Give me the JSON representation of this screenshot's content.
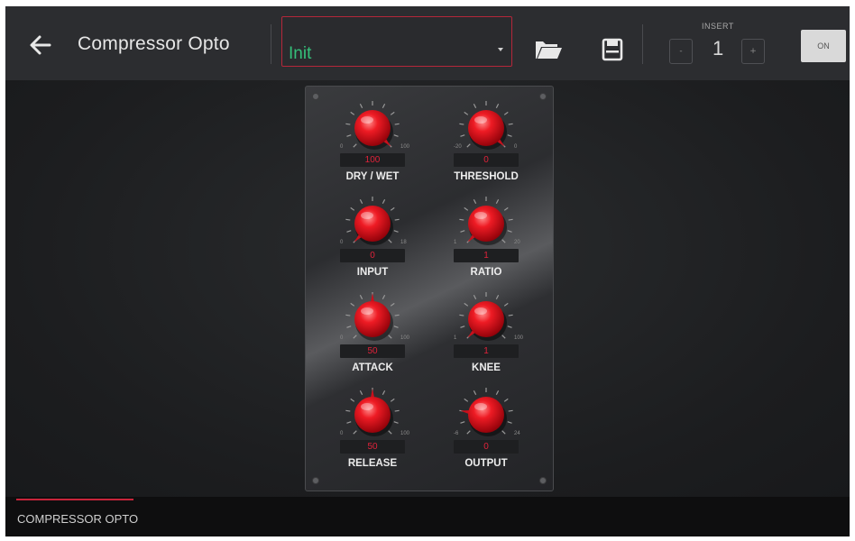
{
  "header": {
    "title": "Compressor Opto",
    "preset_value": "Init",
    "insert_label": "INSERT",
    "insert_value": "1",
    "insert_dec": "-",
    "insert_inc": "+",
    "on_label": "ON",
    "icons": [
      "back-arrow-icon",
      "folder-open-icon",
      "save-icon",
      "caret-down-icon"
    ]
  },
  "knobs": [
    {
      "label": "DRY / WET",
      "value": "100",
      "min": "0",
      "max": "100",
      "fraction": 1.0
    },
    {
      "label": "THRESHOLD",
      "value": "0",
      "min": "-20",
      "max": "0",
      "fraction": 1.0
    },
    {
      "label": "INPUT",
      "value": "0",
      "min": "0",
      "max": "18",
      "fraction": 0.0
    },
    {
      "label": "RATIO",
      "value": "1",
      "min": "1",
      "max": "20",
      "fraction": 0.0
    },
    {
      "label": "ATTACK",
      "value": "50",
      "min": "0",
      "max": "100",
      "fraction": 0.5
    },
    {
      "label": "KNEE",
      "value": "1",
      "min": "1",
      "max": "100",
      "fraction": 0.0
    },
    {
      "label": "RELEASE",
      "value": "50",
      "min": "0",
      "max": "100",
      "fraction": 0.5
    },
    {
      "label": "OUTPUT",
      "value": "0",
      "min": "-6",
      "max": "24",
      "fraction": 0.2
    }
  ],
  "footer": {
    "tab_label": "COMPRESSOR OPTO"
  },
  "colors": {
    "accent_red": "#c7243a",
    "knob_red": "#e0101e",
    "preset_green": "#35c07a",
    "value_red": "#e0223a"
  }
}
